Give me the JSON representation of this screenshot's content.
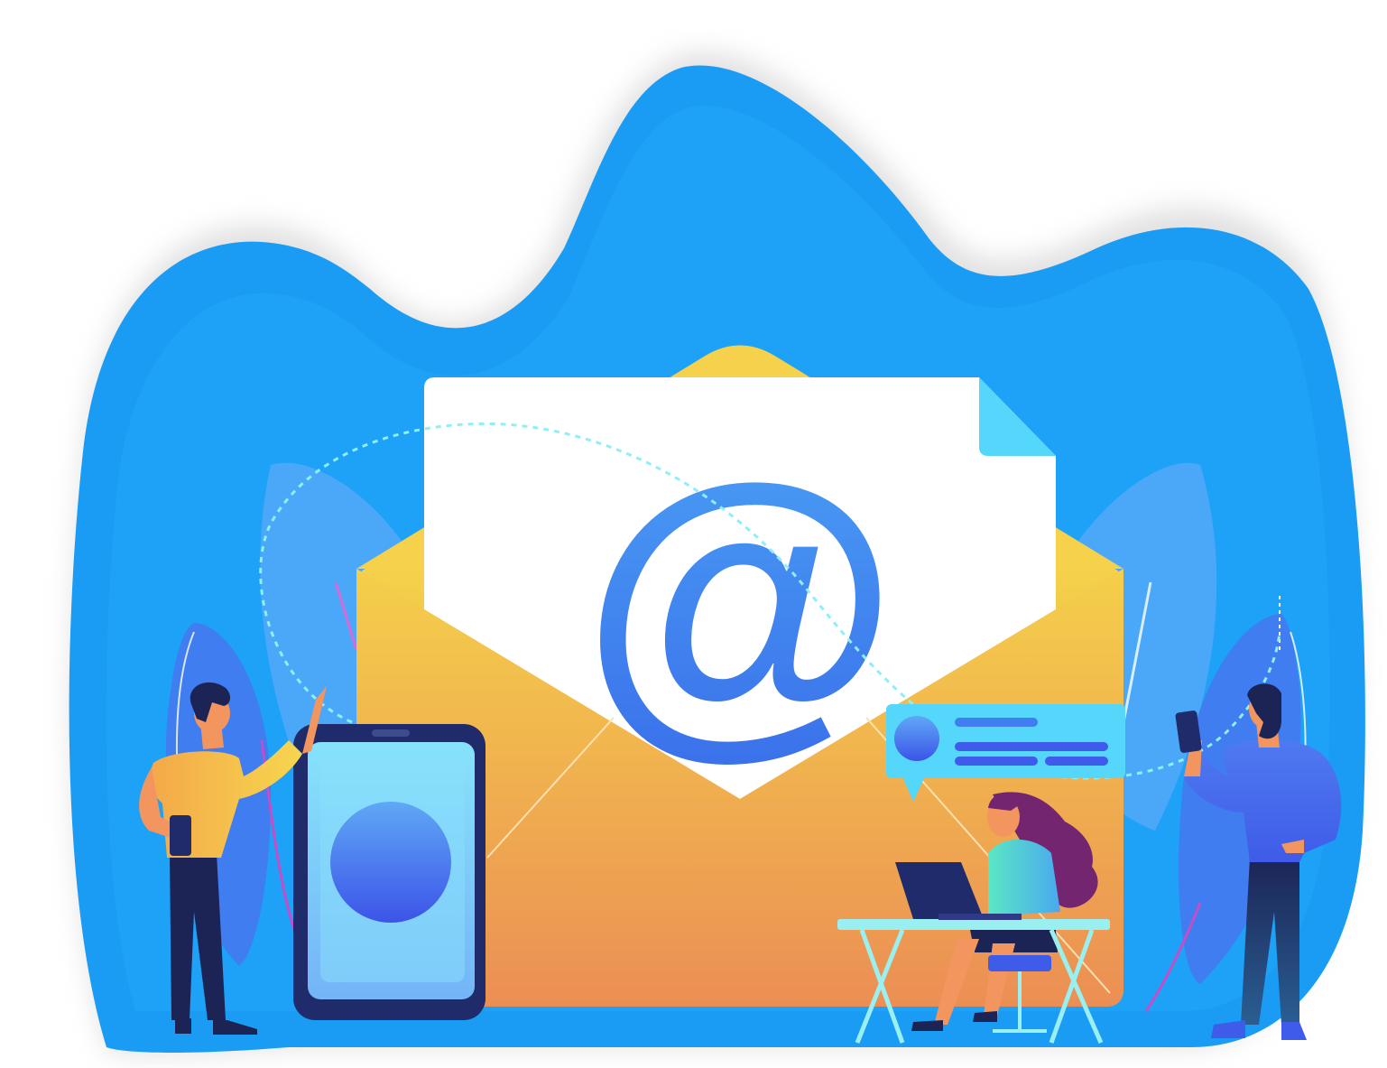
{
  "illustration": {
    "subject": "email marketing",
    "at_symbol": "@",
    "icons": [
      "at-sign-icon",
      "envelope-icon",
      "smartphone-icon",
      "chat-bubble-icon",
      "laptop-icon"
    ]
  },
  "colors": {
    "blob_blue": "#1A9CF5",
    "blob_light": "#4BA8F8",
    "envelope_top": "#F5D24A",
    "envelope_bottom": "#EB8A55",
    "letter_white": "#FFFFFF",
    "at_blue_top": "#4A9FF5",
    "at_blue_bottom": "#3A6FEA",
    "phone_dark": "#1F2B6A",
    "phone_screen": "#7FD6FA",
    "bubble_cyan": "#55D6FB",
    "line_blue": "#3F5BEA",
    "dotted_path": "#8EEFF5",
    "shirt_yellow": "#F6C94A",
    "shirt_blue": "#3F66E8",
    "top_green": "#56E0B6",
    "hair_purple": "#73256F",
    "skin": "#F2955E",
    "pants_navy": "#1C2456",
    "table_cyan": "#9AF0F0"
  }
}
